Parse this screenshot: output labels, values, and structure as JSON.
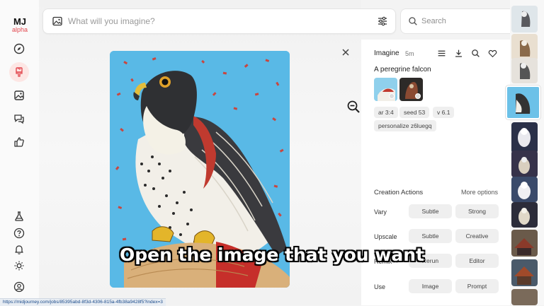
{
  "app": {
    "logo_main": "MJ",
    "logo_sub": "alpha"
  },
  "sidebar": {
    "items": [
      {
        "name": "explore",
        "icon": "compass-icon"
      },
      {
        "name": "create",
        "icon": "brush-icon",
        "active": true
      },
      {
        "name": "organize",
        "icon": "image-icon"
      },
      {
        "name": "chat",
        "icon": "chat-icon"
      },
      {
        "name": "rank",
        "icon": "thumbs-up-icon"
      }
    ],
    "bottom_items": [
      {
        "name": "lab",
        "icon": "flask-icon"
      },
      {
        "name": "help",
        "icon": "help-icon"
      },
      {
        "name": "updates",
        "icon": "bell-icon"
      },
      {
        "name": "theme",
        "icon": "sun-icon"
      },
      {
        "name": "account",
        "icon": "account-icon"
      }
    ]
  },
  "prompt_bar": {
    "placeholder": "What will you imagine?"
  },
  "search": {
    "placeholder": "Search"
  },
  "panel": {
    "title": "Imagine",
    "time": "5m",
    "prompt": "A peregrine falcon",
    "tags": [
      "ar 3:4",
      "seed 53",
      "v 6.1",
      "personalize z6luegq"
    ],
    "creation_actions": {
      "title": "Creation Actions",
      "more": "More options",
      "rows": [
        {
          "label": "Vary",
          "buttons": [
            "Subtle",
            "Strong"
          ]
        },
        {
          "label": "Upscale",
          "buttons": [
            "Subtle",
            "Creative"
          ]
        },
        {
          "label": "Remix",
          "buttons": [
            "Rerun",
            "Editor"
          ]
        },
        {
          "label": "Use",
          "buttons": [
            "Image",
            "Prompt"
          ]
        }
      ]
    }
  },
  "caption": "Open the image that you want",
  "status_url": "https://midjourney.com/jobs/85395abd-8f3d-4306-815a-4fb38a9428f5?index=3",
  "colors": {
    "accent": "#e2474e",
    "artwork_bg": "#59b9e6"
  }
}
